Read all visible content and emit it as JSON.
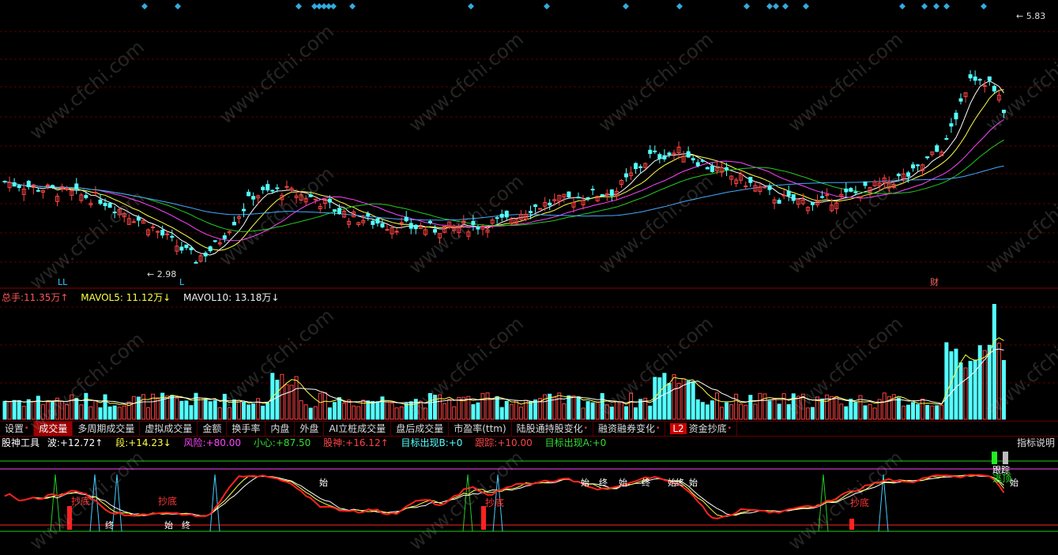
{
  "colors": {
    "up": "#ff4444",
    "down": "#54ffff",
    "ma5": "#ffffff",
    "ma10": "#ffff44",
    "ma20": "#ff44ff",
    "ma30": "#22cc22",
    "ma60": "#44aaff",
    "grid": "#5a0000"
  },
  "watermark": "www.cfchi.com",
  "price_panel": {
    "high_label": "5.83",
    "low_label": "2.98",
    "marker_left_1": "LL",
    "marker_left_2": "L",
    "marker_right": "财"
  },
  "volume_panel": {
    "total_label": "总手:",
    "total_value": "11.35万↑",
    "mavol5_label": "MAVOL5:",
    "mavol5_value": "11.12万↓",
    "mavol10_label": "MAVOL10:",
    "mavol10_value": "13.18万↓"
  },
  "tabs": [
    {
      "label": "设置",
      "dot": true
    },
    {
      "label": "成交量",
      "active": true
    },
    {
      "label": "多周期成交量"
    },
    {
      "label": "虚拟成交量"
    },
    {
      "label": "金额"
    },
    {
      "label": "换手率"
    },
    {
      "label": "内盘"
    },
    {
      "label": "外盘"
    },
    {
      "label": "AI立桩成交量"
    },
    {
      "label": "盘后成交量"
    },
    {
      "label": "市盈率(ttm)"
    },
    {
      "label": "陆股通持股变化",
      "dot": true
    },
    {
      "label": "融资融券变化",
      "dot": true
    },
    {
      "label": "资金抄底",
      "badge": "L2",
      "dot": true
    }
  ],
  "indicator_panel": {
    "name": "股神工具",
    "wave_label": "波:",
    "wave_value": "+12.72↑",
    "seg_label": "段:",
    "seg_value": "+14.23↓",
    "risk_label": "风险:",
    "risk_value": "+80.00",
    "care_label": "小心:",
    "care_value": "+87.50",
    "god_label": "股神:",
    "god_value": "+16.12↑",
    "targetb_label": "目标出现B:",
    "targetb_value": "+0",
    "track_label": "跟踪:",
    "track_value": "+10.00",
    "targeta_label": "目标出现A:",
    "targeta_value": "+0",
    "help": "指标说明",
    "signal_bottom": "抄底",
    "signal_escape": "逃顶",
    "signal_track": "跟踪",
    "signal_start": "始",
    "signal_end": "终"
  }
}
